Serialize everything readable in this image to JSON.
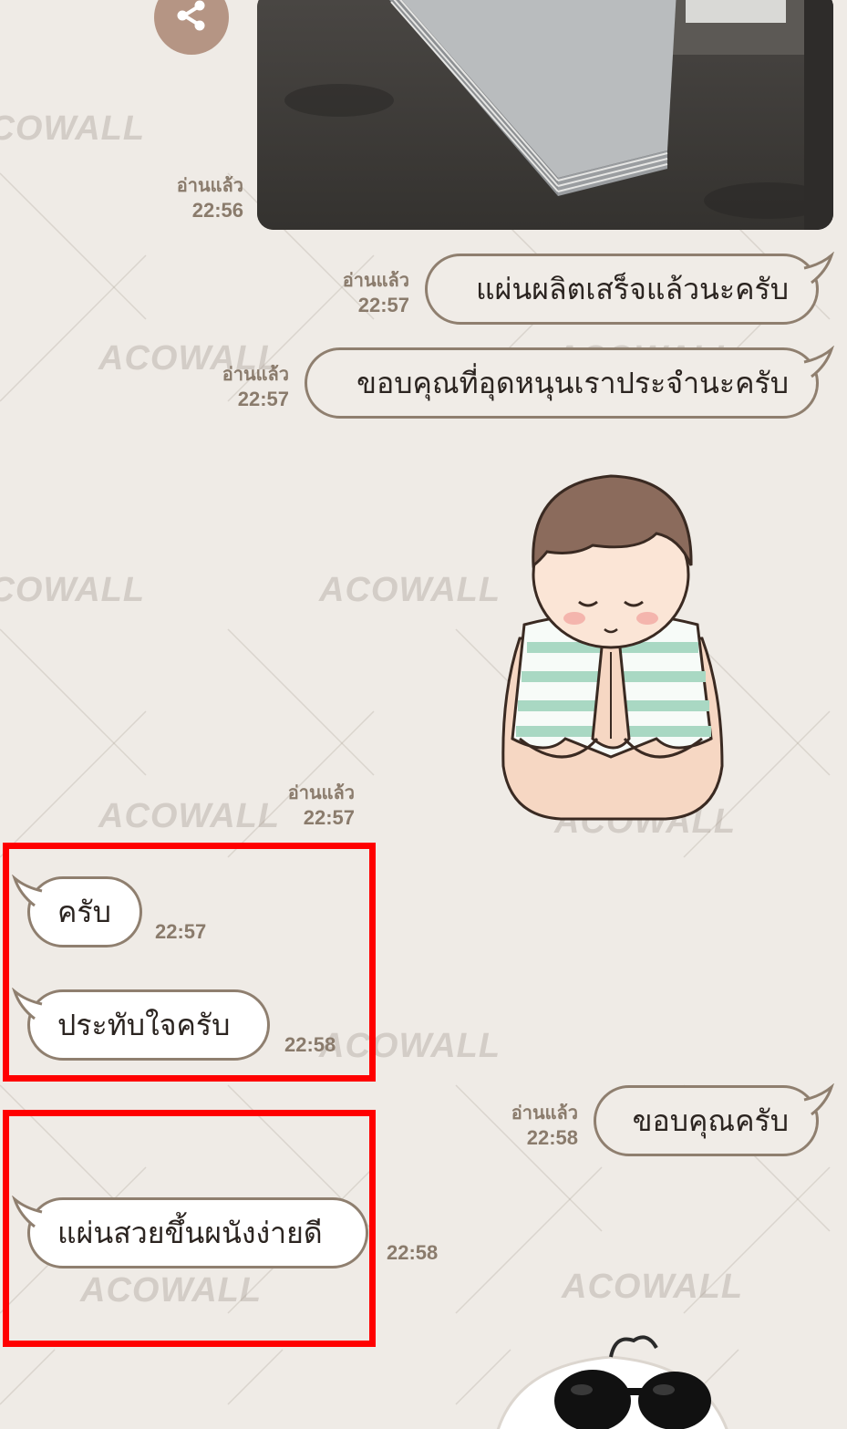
{
  "watermark": "ACOWALL",
  "messages": {
    "photo": {
      "read": "อ่านแล้ว",
      "time": "22:56"
    },
    "m1": {
      "text": "แผ่นผลิตเสร็จแล้วนะครับ",
      "read": "อ่านแล้ว",
      "time": "22:57"
    },
    "m2": {
      "text": "ขอบคุณที่อุดหนุนเราประจำนะครับ",
      "read": "อ่านแล้ว",
      "time": "22:57"
    },
    "sticker1": {
      "read": "อ่านแล้ว",
      "time": "22:57"
    },
    "r1": {
      "text": "ครับ",
      "time": "22:57"
    },
    "r2": {
      "text": "ประทับใจครับ",
      "time": "22:58"
    },
    "m3": {
      "text": "ขอบคุณครับ",
      "read": "อ่านแล้ว",
      "time": "22:58"
    },
    "r3": {
      "text": "แผ่นสวยขึ้นผนังง่ายดี",
      "time": "22:58"
    }
  },
  "colors": {
    "background": "#efebe6",
    "bubble_border": "#8f7f6f",
    "highlight": "#ff0000",
    "share_button": "#b59584",
    "meta_text": "#8a7b6c"
  },
  "icons": {
    "share": "share-icon"
  }
}
